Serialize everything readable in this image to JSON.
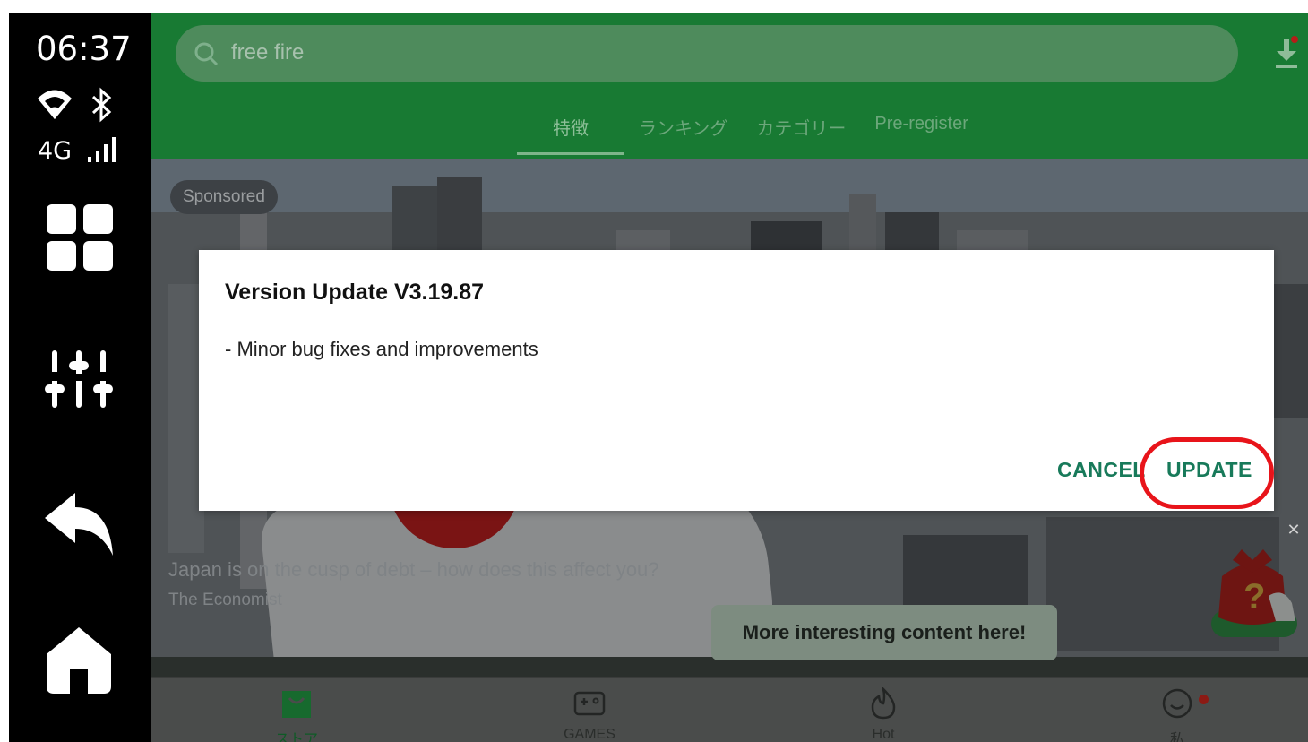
{
  "status_bar": {
    "time": "06:37",
    "network": "4G"
  },
  "app": {
    "search": {
      "value": "free fire"
    },
    "tabs": [
      {
        "label": "特徴",
        "active": true
      },
      {
        "label": "ランキング"
      },
      {
        "label": "カテゴリー"
      },
      {
        "label": "Pre-register"
      }
    ],
    "banner": {
      "sponsored_label": "Sponsored",
      "headline": "Japan is on the cusp of debt – how does this affect you?",
      "source": "The Economist"
    },
    "promo": {
      "text": "More interesting content here!"
    },
    "bottom_nav": [
      {
        "label": "ストア",
        "icon": "store-icon",
        "active": true
      },
      {
        "label": "GAMES",
        "icon": "gamepad-icon"
      },
      {
        "label": "Hot",
        "icon": "flame-icon"
      },
      {
        "label": "私",
        "icon": "smiley-icon"
      }
    ]
  },
  "dialog": {
    "title": "Version Update V3.19.87",
    "body": "- Minor bug fixes and improvements",
    "cancel_label": "CANCEL",
    "update_label": "UPDATE"
  },
  "colors": {
    "app_bar": "#187a33",
    "accent_button": "#187a5a",
    "highlight": "#e8141a",
    "badge": "#d0251c"
  }
}
